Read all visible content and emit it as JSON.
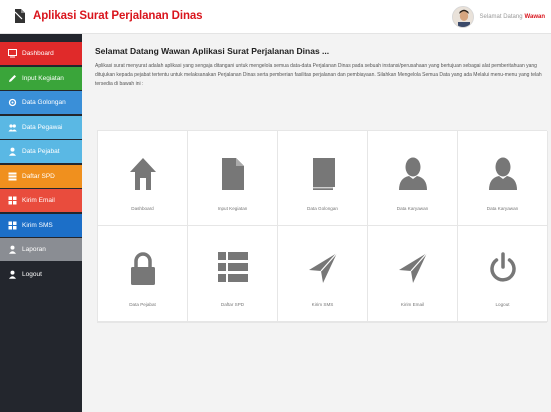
{
  "header": {
    "title": "Aplikasi Surat Perjalanan Dinas",
    "greeting": "Selamat Datang",
    "user_name": "Wawan",
    "brand_icon": "document-icon"
  },
  "colors": {
    "brand_red": "#d9141c",
    "sidebar_bg": "#23262d",
    "icon_gray": "#777777"
  },
  "sidebar": {
    "items": [
      {
        "label": "Dashboard",
        "icon": "monitor-icon",
        "color": "#e02a2a"
      },
      {
        "label": "Input Kegiatan",
        "icon": "pencil-icon",
        "color": "#3aa53a"
      },
      {
        "label": "Data Golongan",
        "icon": "gear-icon",
        "color": "#3a8fd8"
      },
      {
        "label": "Data Pegawai",
        "icon": "users-icon",
        "color": "#5ab8e4"
      },
      {
        "label": "Data Pejabat",
        "icon": "user-icon",
        "color": "#5ab8e4"
      },
      {
        "label": "Daftar SPD",
        "icon": "list-icon",
        "color": "#f0901e"
      },
      {
        "label": "Kirim Email",
        "icon": "grid-icon",
        "color": "#e94c3d"
      },
      {
        "label": "Kirim SMS",
        "icon": "grid-icon",
        "color": "#1c6fc8"
      },
      {
        "label": "Laporan",
        "icon": "user-icon",
        "color": "#8a8d93"
      },
      {
        "label": "Logout",
        "icon": "user-icon",
        "color": "#23262d"
      }
    ]
  },
  "main": {
    "title": "Selamat Datang Wawan Aplikasi Surat Perjalanan Dinas ...",
    "intro": "Aplikasi surat menyurat adalah aplikasi yang sengaja ditangani untuk mengelola semua data-data Perjalanan Dinas pada sebuah instansi/perusahaan yang bertujuan sebagai alat pemberitahuan yang ditujukan kepada pejabat tertentu untuk melaksanakan Perjalanan Dinas serta pemberian fasilitas perjalanan dan pembiayaan. Silahkan Mengelola Semua Data yang ada Melalui menu-menu yang telah tersedia di bawah ini :",
    "tiles": [
      {
        "label": "Dashboard",
        "icon": "home-icon"
      },
      {
        "label": "Input Kegiatan",
        "icon": "file-icon"
      },
      {
        "label": "Data Golongan",
        "icon": "book-icon"
      },
      {
        "label": "Data Karyawan",
        "icon": "user-icon"
      },
      {
        "label": "Data Karyawan",
        "icon": "user-icon"
      },
      {
        "label": "Data Pejabat",
        "icon": "lock-icon"
      },
      {
        "label": "Daftar SPD",
        "icon": "list-icon"
      },
      {
        "label": "Kirim SMS",
        "icon": "send-icon"
      },
      {
        "label": "Kirim Email",
        "icon": "send-icon"
      },
      {
        "label": "Logout",
        "icon": "power-icon"
      }
    ]
  }
}
